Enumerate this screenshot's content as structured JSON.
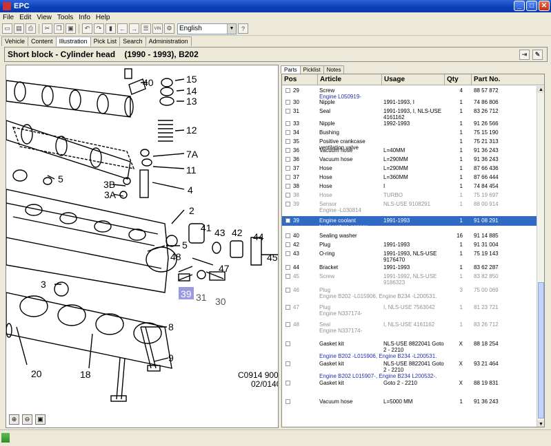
{
  "window": {
    "title": "EPC"
  },
  "menu": [
    "File",
    "Edit",
    "View",
    "Tools",
    "Info",
    "Help"
  ],
  "toolbar": {
    "language": "English",
    "vin_label": "VIN",
    "help_label": "?"
  },
  "main_tabs": [
    "Vehicle",
    "Content",
    "Illustration",
    "Pick List",
    "Search",
    "Administration"
  ],
  "header": {
    "title": "Short block - Cylinder head    (1990 - 1993), B202"
  },
  "illustration": {
    "callouts": [
      "40",
      "15",
      "14",
      "13",
      "12",
      "7A",
      "11",
      "4",
      "5",
      "3B",
      "3A",
      "2",
      "41",
      "43",
      "42",
      "44",
      "5",
      "48",
      "47",
      "45",
      "3",
      "39",
      "31",
      "30",
      "8",
      "9",
      "18",
      "20"
    ],
    "code_line1": "C0914 9000",
    "code_line2": "02/0140"
  },
  "right_tabs": [
    "Parts",
    "Picklist",
    "Notes"
  ],
  "columns": {
    "pos": "Pos",
    "article": "Article",
    "usage": "Usage",
    "qty": "Qty",
    "part_no": "Part No."
  },
  "rows": [
    {
      "pos": "29",
      "article": "Screw",
      "usage": "",
      "qty": "4",
      "part_no": "88 57 872",
      "sub": "Engine L050919-"
    },
    {
      "pos": "30",
      "article": "Nipple",
      "usage": "1991-1993, I",
      "qty": "1",
      "part_no": "74 86 806",
      "sub": ""
    },
    {
      "pos": "31",
      "article": "Seal",
      "usage": "1991-1993, I, NLS-USE 4161162",
      "qty": "1",
      "part_no": "83 26 712",
      "sub": ""
    },
    {
      "pos": "33",
      "article": "Nipple",
      "usage": "1992-1993",
      "qty": "1",
      "part_no": "91 26 566",
      "sub": ""
    },
    {
      "pos": "34",
      "article": "Bushing",
      "usage": "",
      "qty": "1",
      "part_no": "75 15 190",
      "sub": ""
    },
    {
      "pos": "35",
      "article": "Positive crankcase ventilation valve",
      "usage": "",
      "qty": "1",
      "part_no": "75 21 313",
      "sub": ""
    },
    {
      "pos": "36",
      "article": "Vacuum hose",
      "usage": "L=40MM",
      "qty": "1",
      "part_no": "91 36 243",
      "sub": ""
    },
    {
      "pos": "36",
      "article": "Vacuum hose",
      "usage": "L=290MM",
      "qty": "1",
      "part_no": "91 36 243",
      "sub": ""
    },
    {
      "pos": "37",
      "article": "Hose",
      "usage": "L=290MM",
      "qty": "1",
      "part_no": "87 66 436",
      "sub": ""
    },
    {
      "pos": "37",
      "article": "Hose",
      "usage": "L=360MM",
      "qty": "1",
      "part_no": "87 66 444",
      "sub": ""
    },
    {
      "pos": "38",
      "article": "Hose",
      "usage": "I",
      "qty": "1",
      "part_no": "74 84 454",
      "sub": ""
    },
    {
      "pos": "38",
      "article": "Hose",
      "usage": "TURBO",
      "qty": "1",
      "part_no": "75 19 697",
      "sub": ""
    },
    {
      "pos": "39",
      "article": "Sensor",
      "usage": "NLS-USE 9108291",
      "qty": "1",
      "part_no": "88 00 914",
      "sub": "Engine -L030814"
    },
    {
      "pos": "39",
      "article": "Engine coolant temperature sensor",
      "usage": "1991-1993",
      "qty": "1",
      "part_no": "91 08 291",
      "sub": ""
    },
    {
      "pos": "40",
      "article": "Sealing washer",
      "usage": "",
      "qty": "16",
      "part_no": "91 14 885",
      "sub": ""
    },
    {
      "pos": "42",
      "article": "Plug",
      "usage": "1991-1993",
      "qty": "1",
      "part_no": "91 31 004",
      "sub": ""
    },
    {
      "pos": "43",
      "article": "O-ring",
      "usage": "1991-1993, NLS-USE 9176470",
      "qty": "1",
      "part_no": "75 19 143",
      "sub": ""
    },
    {
      "pos": "44",
      "article": "Bracket",
      "usage": "1991-1993",
      "qty": "1",
      "part_no": "83 62 287",
      "sub": ""
    },
    {
      "pos": "45",
      "article": "Screw",
      "usage": "1991-1992, NLS-USE 9186323",
      "qty": "1",
      "part_no": "83 82 850",
      "sub": ""
    },
    {
      "pos": "46",
      "article": "Plug",
      "usage": "",
      "qty": "3",
      "part_no": "75 00 069",
      "sub": "Engine B202 -L015906, Engine B234 -L200531."
    },
    {
      "pos": "47",
      "article": "Plug",
      "usage": "I, NLS-USE 7563042",
      "qty": "1",
      "part_no": "81 23 721",
      "sub": "Engine N337174-"
    },
    {
      "pos": "48",
      "article": "Seal",
      "usage": "I, NLS-USE 4161162",
      "qty": "1",
      "part_no": "83 26 712",
      "sub": "Engine N337174-"
    },
    {
      "pos": "",
      "article": "Gasket kit",
      "usage": "NLS-USE 8822041 Goto 2 - 2210",
      "qty": "X",
      "part_no": "88 18 254",
      "sub": "Engine B202 -L015906, Engine B234 -L200531."
    },
    {
      "pos": "",
      "article": "Gasket kit",
      "usage": "NLS-USE 8822041 Goto 2 - 2210",
      "qty": "X",
      "part_no": "93 21 464",
      "sub": "Engine B202 L015907-, Engine B234 L200532-."
    },
    {
      "pos": "",
      "article": "Gasket kit",
      "usage": "Goto 2 - 2210",
      "qty": "X",
      "part_no": "88 19 831",
      "sub": ""
    },
    {
      "pos": "",
      "article": "Vacuum hose",
      "usage": "L=5000 MM",
      "qty": "1",
      "part_no": "91 36 243",
      "sub": ""
    }
  ]
}
